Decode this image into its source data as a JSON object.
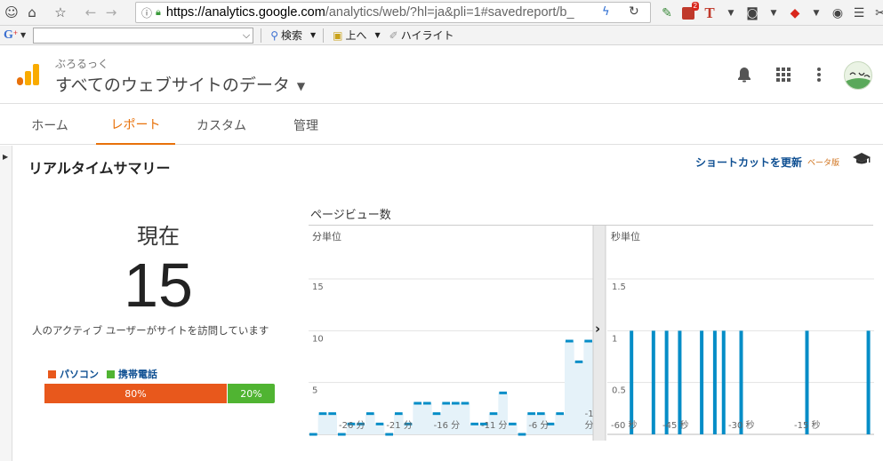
{
  "browser": {
    "url_host": "https://analytics.google.com",
    "url_path": "/analytics/web/?hl=ja&pli=1#savedreport/b_",
    "notification_count": "2",
    "search_button": "検索",
    "up_button": "上へ",
    "highlight_button": "ハイライト"
  },
  "header": {
    "account_sub": "ぶろるっく",
    "account_main": "すべてのウェブサイトのデータ"
  },
  "nav": {
    "tabs": [
      {
        "label": "ホーム"
      },
      {
        "label": "レポート"
      },
      {
        "label": "カスタム"
      },
      {
        "label": "管理"
      }
    ],
    "active_tab": "レポート"
  },
  "page": {
    "title": "リアルタイムサマリー",
    "shortcut_label": "ショートカットを更新",
    "beta_label": "ベータ版"
  },
  "summary": {
    "now_label": "現在",
    "active_users": "15",
    "description": "人のアクティブ ユーザーがサイトを訪問しています",
    "legend": [
      {
        "label": "パソコン",
        "color": "#e8581c"
      },
      {
        "label": "携帯電話",
        "color": "#50b432"
      }
    ],
    "device_split": [
      {
        "label": "80%",
        "value": 0.8,
        "color": "#e8581c"
      },
      {
        "label": "20%",
        "value": 0.2,
        "color": "#50b432"
      }
    ]
  },
  "chart_data": [
    {
      "type": "area",
      "title": "ページビュー数",
      "subtitle": "分単位",
      "yticks": [
        5,
        10,
        15
      ],
      "ylim": [
        0,
        15
      ],
      "x_tick_labels": [
        "-26 分",
        "-21 分",
        "-16 分",
        "-11 分",
        "-6 分",
        "-1 分"
      ],
      "x": [
        -30,
        -29,
        -28,
        -27,
        -26,
        -25,
        -24,
        -23,
        -22,
        -21,
        -20,
        -19,
        -18,
        -17,
        -16,
        -15,
        -14,
        -13,
        -12,
        -11,
        -10,
        -9,
        -8,
        -7,
        -6,
        -5,
        -4,
        -3,
        -2,
        -1
      ],
      "values": [
        0,
        2,
        2,
        0,
        1,
        1,
        2,
        1,
        0,
        2,
        1,
        3,
        3,
        2,
        3,
        3,
        3,
        1,
        1,
        2,
        4,
        1,
        0,
        2,
        2,
        1,
        2,
        9,
        7,
        9
      ],
      "color": "#058dc7"
    },
    {
      "type": "bar",
      "subtitle": "秒単位",
      "yticks": [
        0.5,
        1,
        1.5
      ],
      "ylim": [
        0,
        1.5
      ],
      "x_tick_labels": [
        "-60 秒",
        "-45 秒",
        "-30 秒",
        "-15 秒"
      ],
      "x": [
        -55,
        -50,
        -47,
        -44,
        -39,
        -36,
        -34,
        -30,
        -15,
        -1
      ],
      "values": [
        1,
        1,
        1,
        1,
        1,
        1,
        1,
        1,
        1,
        1
      ],
      "color": "#058dc7"
    }
  ]
}
